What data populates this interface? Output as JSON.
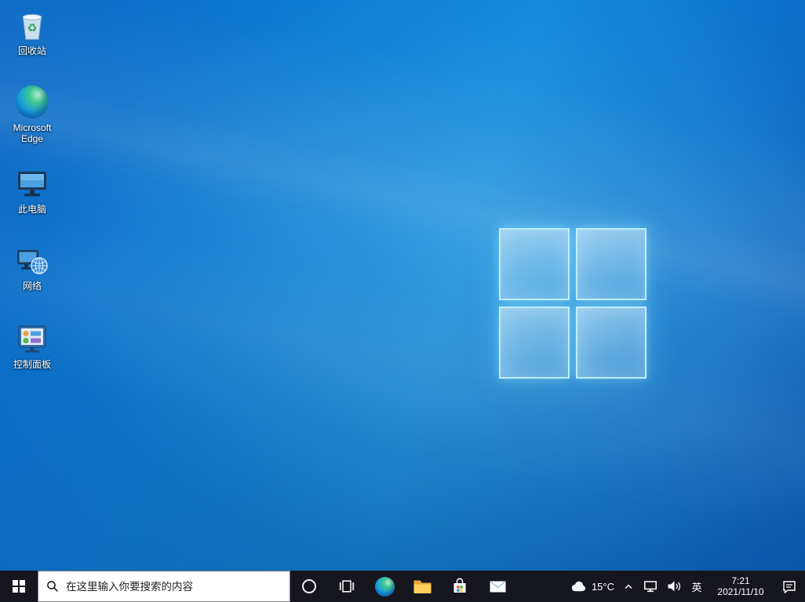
{
  "desktop_icons": [
    {
      "label": "回收站",
      "icon": "recycle-bin-icon"
    },
    {
      "label": "Microsoft Edge",
      "icon": "edge-icon"
    },
    {
      "label": "此电脑",
      "icon": "this-pc-icon"
    },
    {
      "label": "网络",
      "icon": "network-icon"
    },
    {
      "label": "控制面板",
      "icon": "control-panel-icon"
    }
  ],
  "taskbar": {
    "start": {
      "icon": "windows-start-icon"
    },
    "search": {
      "placeholder": "在这里输入你要搜索的内容",
      "icon": "search-icon"
    },
    "app_buttons": [
      {
        "icon": "cortana-icon"
      },
      {
        "icon": "task-view-icon"
      },
      {
        "icon": "edge-icon"
      },
      {
        "icon": "file-explorer-icon"
      },
      {
        "icon": "microsoft-store-icon"
      },
      {
        "icon": "mail-icon"
      }
    ],
    "tray": {
      "weather": {
        "icon": "cloud-icon",
        "temperature": "15°C"
      },
      "ime": "英",
      "clock": {
        "time": "7:21",
        "date": "2021/11/10"
      }
    }
  },
  "colors": {
    "taskbar_bg": "#16161f",
    "wallpaper_accent": "#1488da",
    "logo_glow": "#c3f2ff"
  }
}
